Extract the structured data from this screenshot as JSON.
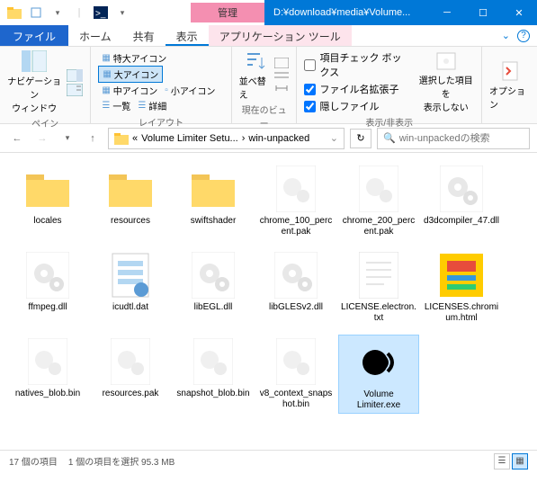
{
  "titlebar": {
    "context_tab": "管理",
    "path": "D:¥download¥media¥Volume..."
  },
  "menubar": {
    "file": "ファイル",
    "tabs": [
      "ホーム",
      "共有",
      "表示",
      "アプリケーション ツール"
    ]
  },
  "ribbon": {
    "nav_pane": "ナビゲーション\nウィンドウ",
    "g_pane": "ペイン",
    "v_extra_large": "特大アイコン",
    "v_large": "大アイコン",
    "v_medium": "中アイコン",
    "v_small": "小アイコン",
    "v_list": "一覧",
    "v_details": "詳細",
    "g_layout": "レイアウト",
    "sort": "並べ替え",
    "g_view": "現在のビュー",
    "cb_checkboxes": "項目チェック ボックス",
    "cb_extensions": "ファイル名拡張子",
    "cb_hidden": "隠しファイル",
    "hide_selected": "選択した項目を\n表示しない",
    "g_showhide": "表示/非表示",
    "options": "オプション"
  },
  "address": {
    "crumb1": "Volume Limiter Setu...",
    "crumb2": "win-unpacked"
  },
  "search": {
    "placeholder": "win-unpackedの検索"
  },
  "items": [
    {
      "name": "locales",
      "type": "folder"
    },
    {
      "name": "resources",
      "type": "folder"
    },
    {
      "name": "swiftshader",
      "type": "folder"
    },
    {
      "name": "chrome_100_percent.pak",
      "type": "file"
    },
    {
      "name": "chrome_200_percent.pak",
      "type": "file"
    },
    {
      "name": "d3dcompiler_47.dll",
      "type": "dll"
    },
    {
      "name": "ffmpeg.dll",
      "type": "dll"
    },
    {
      "name": "icudtl.dat",
      "type": "dat"
    },
    {
      "name": "libEGL.dll",
      "type": "dll"
    },
    {
      "name": "libGLESv2.dll",
      "type": "dll"
    },
    {
      "name": "LICENSE.electron.txt",
      "type": "txt"
    },
    {
      "name": "LICENSES.chromium.html",
      "type": "html"
    },
    {
      "name": "natives_blob.bin",
      "type": "file"
    },
    {
      "name": "resources.pak",
      "type": "file"
    },
    {
      "name": "snapshot_blob.bin",
      "type": "file"
    },
    {
      "name": "v8_context_snapshot.bin",
      "type": "file"
    },
    {
      "name": "Volume Limiter.exe",
      "type": "exe",
      "selected": true
    }
  ],
  "status": {
    "count": "17 個の項目",
    "selected": "1 個の項目を選択 95.3 MB"
  }
}
